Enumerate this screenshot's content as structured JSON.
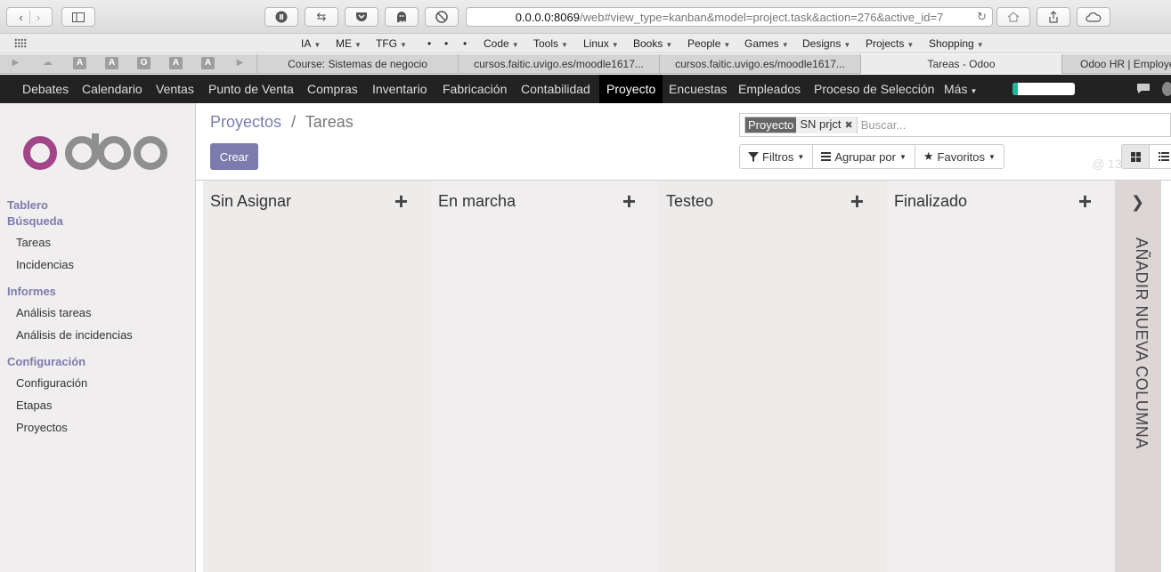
{
  "browser": {
    "url_host": "0.0.0.0:8069",
    "url_path": "/web#view_type=kanban&model=project.task&action=276&active_id=7",
    "bookmarks": [
      "IA",
      "ME",
      "TFG",
      "•",
      "•",
      "•",
      "Code",
      "Tools",
      "Linux",
      "Books",
      "People",
      "Games",
      "Designs",
      "Projects",
      "Shopping"
    ],
    "pinned_tabs": [
      "A",
      "A",
      "O",
      "A",
      "A"
    ],
    "tabs": [
      {
        "label": "Course: Sistemas de negocio",
        "active": false
      },
      {
        "label": "cursos.faitic.uvigo.es/moodle1617...",
        "active": false
      },
      {
        "label": "cursos.faitic.uvigo.es/moodle1617...",
        "active": false
      },
      {
        "label": "Tareas - Odoo",
        "active": true
      },
      {
        "label": "Odoo HR | Employee",
        "active": false
      }
    ]
  },
  "topbar": {
    "menus": [
      "Debates",
      "Calendario",
      "Ventas",
      "Punto de Venta",
      "Compras",
      "Inventario",
      "Fabricación",
      "Contabilidad",
      "Proyecto",
      "Encuestas",
      "Empleados",
      "Proceso de Selección",
      "Más"
    ],
    "active_menu": "Proyecto",
    "progress_fraction": 0.08,
    "message_count": "@ 13",
    "accent": "#21b799"
  },
  "sidebar": {
    "sections": [
      {
        "title": "Tablero",
        "items": []
      },
      {
        "title": "Búsqueda",
        "items": [
          "Tareas",
          "Incidencias"
        ]
      },
      {
        "title": "Informes",
        "items": [
          "Análisis tareas",
          "Análisis de incidencias"
        ]
      },
      {
        "title": "Configuración",
        "items": [
          "Configuración",
          "Etapas",
          "Proyectos"
        ]
      }
    ]
  },
  "control_panel": {
    "breadcrumb_root": "Proyectos",
    "breadcrumb_separator": "/",
    "breadcrumb_current": "Tareas",
    "create_label": "Crear",
    "facet_label": "Proyecto",
    "facet_value": "SN prjct",
    "search_placeholder": "Buscar...",
    "filters_label": "Filtros",
    "groupby_label": "Agrupar por",
    "favorites_label": "Favoritos",
    "brand_color": "#7c7bad"
  },
  "kanban": {
    "columns": [
      "Sin Asignar",
      "En marcha",
      "Testeo",
      "Finalizado"
    ],
    "add_column_label": "AÑADIR NUEVA COLUMNA"
  }
}
